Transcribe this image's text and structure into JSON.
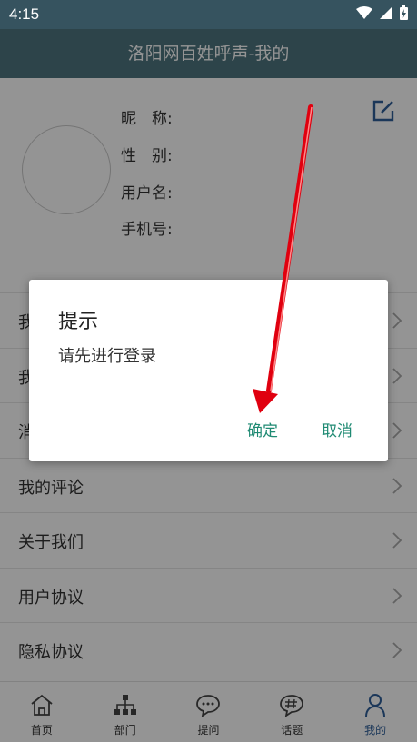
{
  "status": {
    "time": "4:15"
  },
  "appbar": {
    "title": "洛阳网百姓呼声-我的"
  },
  "profile": {
    "nickname_label": "昵　称:",
    "gender_label": "性　别:",
    "username_label": "用户名:",
    "phone_label": "手机号:"
  },
  "menu": {
    "items": [
      {
        "label": "我"
      },
      {
        "label": "我"
      },
      {
        "label": "消"
      },
      {
        "label": "我的评论"
      },
      {
        "label": "关于我们"
      },
      {
        "label": "用户协议"
      },
      {
        "label": "隐私协议"
      }
    ]
  },
  "tabs": [
    {
      "label": "首页"
    },
    {
      "label": "部门"
    },
    {
      "label": "提问"
    },
    {
      "label": "话题"
    },
    {
      "label": "我的"
    }
  ],
  "dialog": {
    "title": "提示",
    "message": "请先进行登录",
    "confirm_label": "确定",
    "cancel_label": "取消"
  },
  "colors": {
    "accent": "#1f8a73",
    "active_tab": "#2f5f9a",
    "appbar": "#4e7680"
  }
}
